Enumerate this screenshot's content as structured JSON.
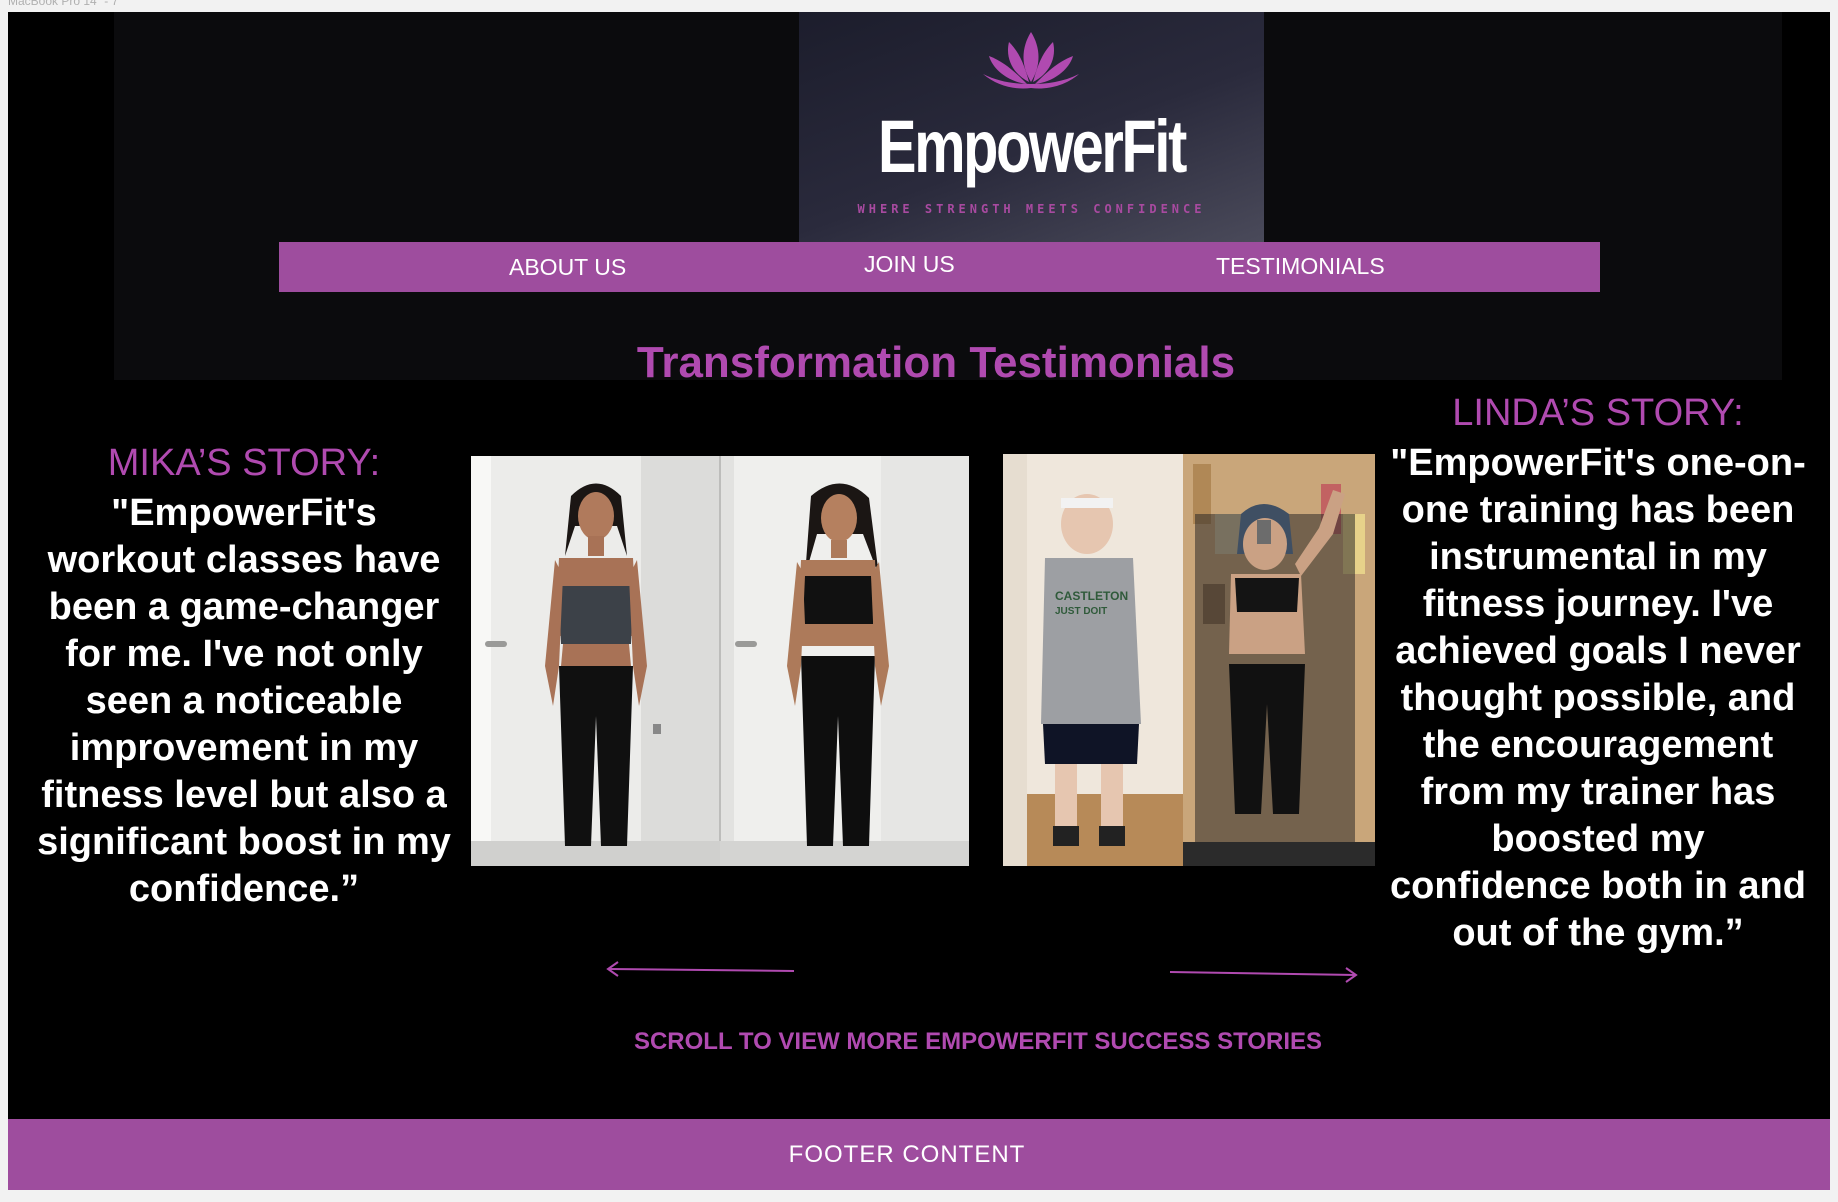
{
  "frame": {
    "label": "MacBook Pro 14\" - 7"
  },
  "brand": {
    "name": "EmpowerFit",
    "tagline": "WHERE STRENGTH MEETS CONFIDENCE",
    "logo_icon": "lotus-flower-icon",
    "colors": {
      "accent": "#9e4d9e",
      "heading": "#b04ab0",
      "background": "#000000"
    }
  },
  "nav": {
    "items": [
      {
        "label": "ABOUT US"
      },
      {
        "label": "JOIN US"
      },
      {
        "label": "TESTIMONIALS"
      }
    ]
  },
  "main": {
    "title": "Transformation Testimonials",
    "stories": [
      {
        "heading": "MIKA’S STORY:",
        "quote": "\"EmpowerFit's workout classes have been a game-changer for me. I've not only seen a noticeable improvement in my fitness level but also a significant boost in my confidence.”"
      },
      {
        "heading": "LINDA’S STORY:",
        "quote": "\"EmpowerFit's one-on-one training has been instrumental in my fitness journey. I've achieved goals I never thought possible, and the encouragement from my trainer has boosted my confidence both in and out of the gym.”"
      }
    ],
    "scroll_hint": "SCROLL TO VIEW MORE EMPOWERFIT SUCCESS STORIES",
    "arrows": {
      "left_icon": "arrow-left-icon",
      "right_icon": "arrow-right-icon"
    }
  },
  "footer": {
    "label": "FOOTER CONTENT"
  }
}
